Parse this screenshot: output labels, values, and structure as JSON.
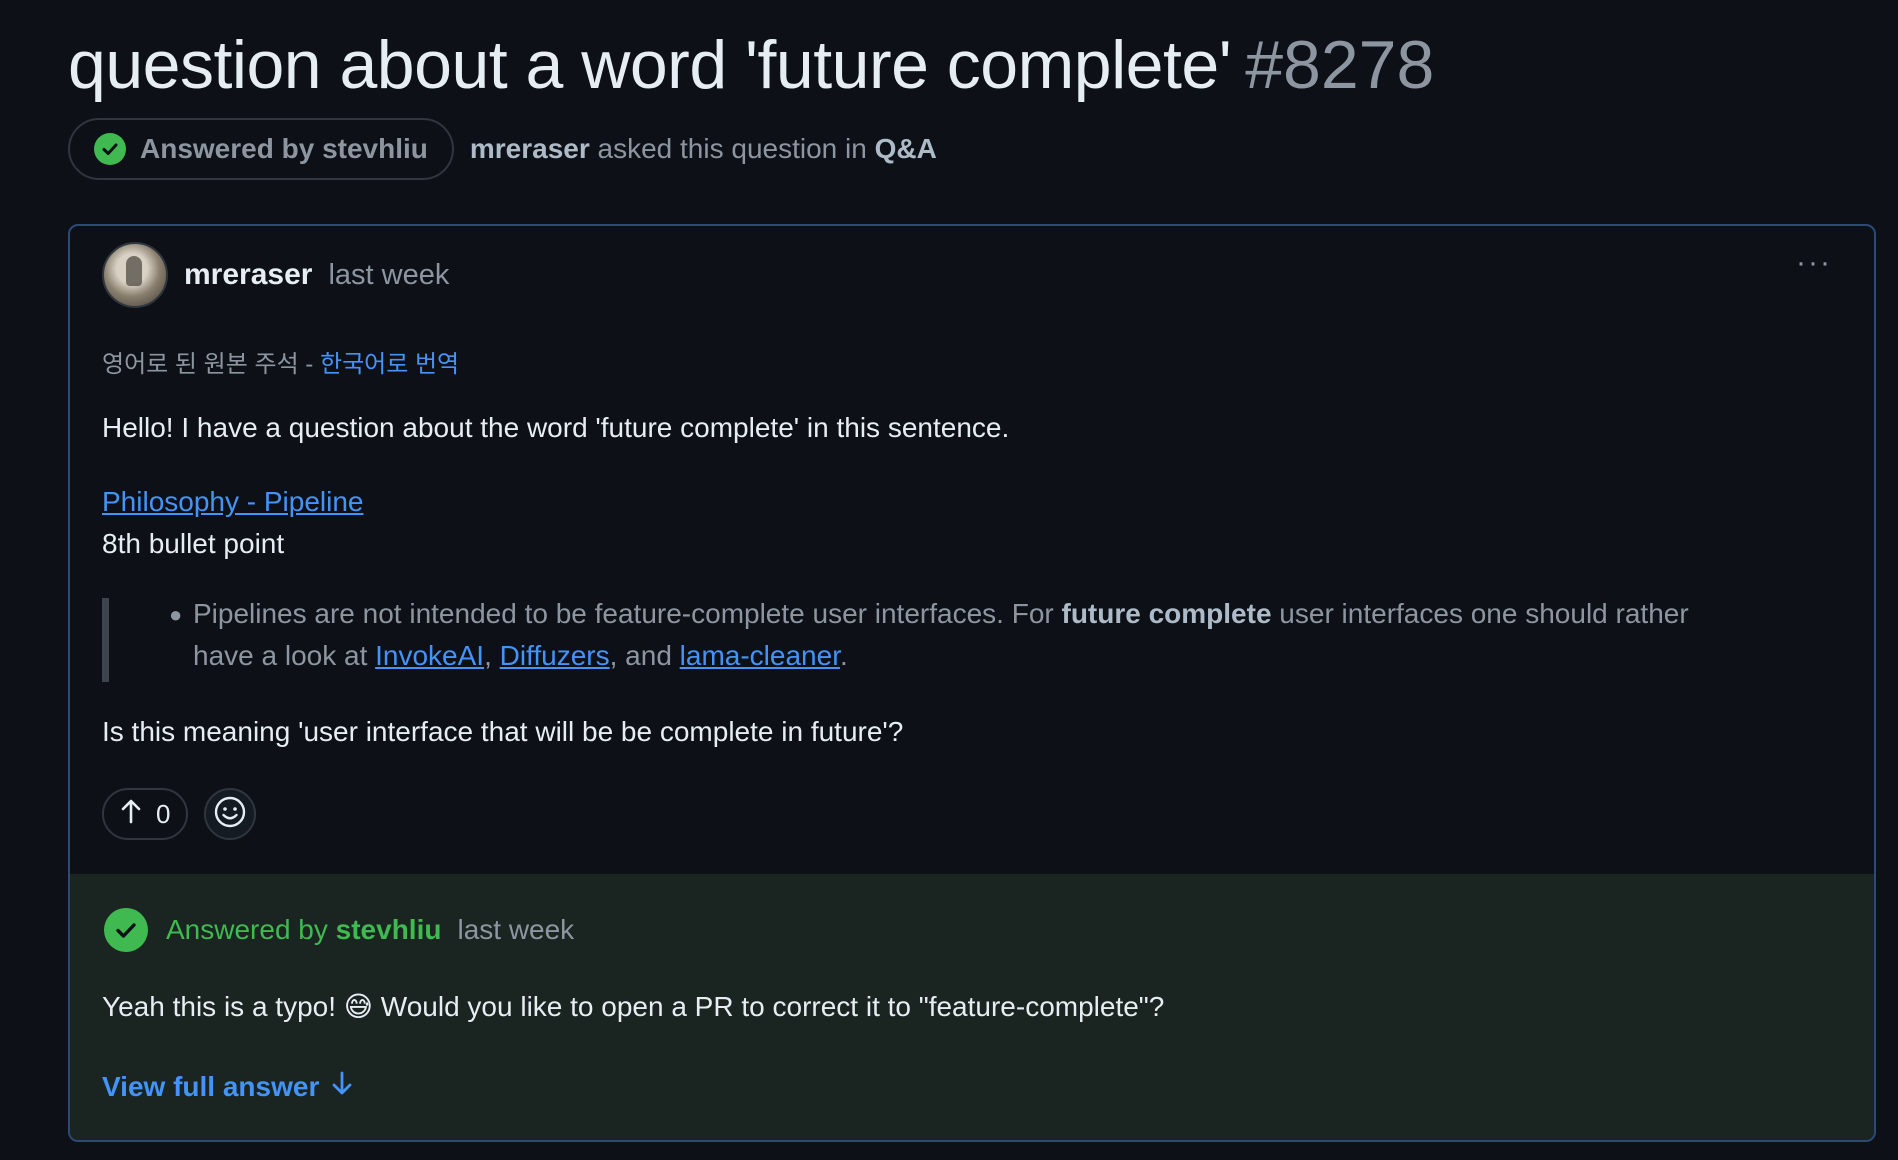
{
  "header": {
    "title": "question about a word 'future complete'",
    "number": "#8278"
  },
  "meta": {
    "answered_prefix": "Answered by",
    "answered_user": "stevhliu",
    "asker": "mreraser",
    "asked_text": "asked this question in",
    "category": "Q&A"
  },
  "post": {
    "author": "mreraser",
    "time": "last week",
    "more_label": "···",
    "translate_text": "영어로 된 원본 주석 - ",
    "translate_link": "한국어로 번역",
    "paragraph1": "Hello! I have a question about the word 'future complete' in this sentence.",
    "link_text": "Philosophy - Pipeline",
    "bullet_point_text": "8th bullet point",
    "quote": {
      "part1": "Pipelines are not intended to be feature-complete user interfaces. For ",
      "bold": "future complete",
      "part2": " user interfaces one should rather",
      "line2_prefix": "have a look at ",
      "link1": "InvokeAI",
      "sep1": ", ",
      "link2": "Diffuzers",
      "sep2": ", and ",
      "link3": "lama-cleaner",
      "end": "."
    },
    "question": "Is this meaning 'user interface that will be be complete in future'?",
    "upvotes": "0"
  },
  "answer": {
    "prefix": "Answered by",
    "user": "stevhliu",
    "time": "last week",
    "text_before_emoji": "Yeah this is a typo! ",
    "emoji": "😅",
    "text_after_emoji": " Would you like to open a PR to correct it to \"feature-complete\"?",
    "view_full": "View full answer"
  },
  "colors": {
    "background": "#0d1117",
    "success": "#3fb950",
    "link": "#4493f8",
    "muted": "#8d96a0"
  },
  "icons": [
    "check-circle-icon",
    "kebab-icon",
    "arrow-up-icon",
    "smiley-icon",
    "arrow-down-icon"
  ]
}
